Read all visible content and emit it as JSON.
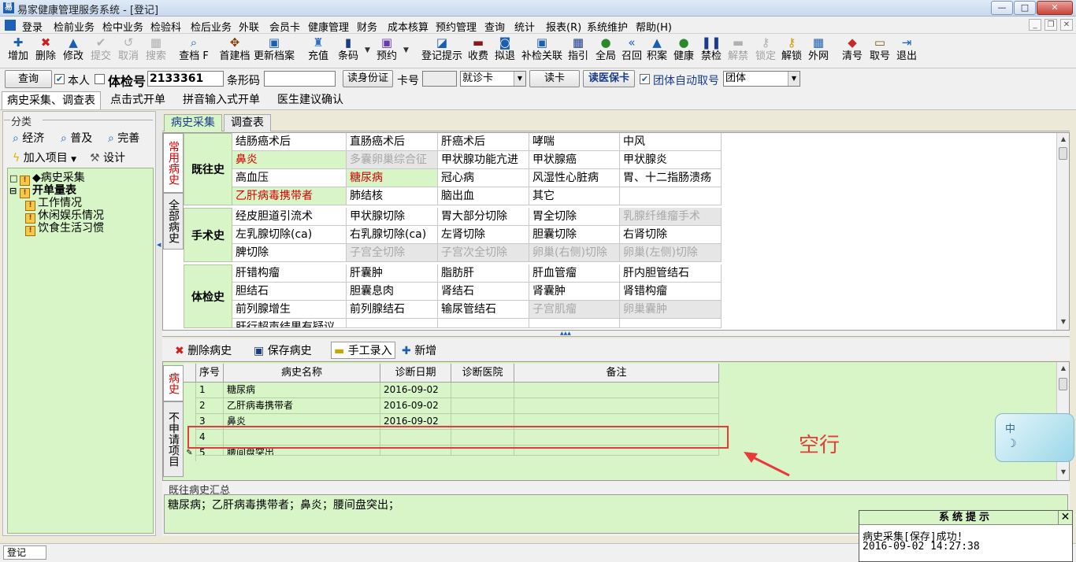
{
  "window": {
    "title": "易家健康管理服务系统 - [登记]",
    "app_icon": "app-logo-icon",
    "btn_min": "—",
    "btn_max": "□",
    "btn_close": "✕"
  },
  "menubar": [
    "登录",
    "检前业务",
    "检中业务",
    "检验科",
    "检后业务",
    "外联",
    "会员卡",
    "健康管理",
    "财务",
    "成本核算",
    "预约管理",
    "查询",
    "统计",
    "报表(R)",
    "系统维护",
    "帮助(H)"
  ],
  "mdi": [
    "_",
    "❐",
    "✕"
  ],
  "toolbar": [
    {
      "label": "增加",
      "icon": "✚",
      "color": "#1a5fb4"
    },
    {
      "label": "删除",
      "icon": "✖",
      "color": "#d21c1c"
    },
    {
      "label": "修改",
      "icon": "▲",
      "color": "#1a5fb4"
    },
    {
      "label": "提交",
      "icon": "✔",
      "color": "#b0b0b0",
      "disabled": true
    },
    {
      "label": "取消",
      "icon": "↺",
      "color": "#b0b0b0",
      "disabled": true
    },
    {
      "label": "搜索",
      "icon": "▦",
      "color": "#b0b0b0",
      "disabled": true
    },
    {
      "label": "查档 F",
      "icon": "⌕",
      "color": "#1a5fb4"
    },
    {
      "label": "首建档",
      "icon": "✥",
      "color": "#8a3a00"
    },
    {
      "label": "更新档案",
      "icon": "▣",
      "color": "#1a5fb4"
    },
    {
      "label": "充值",
      "icon": "♜",
      "color": "#2a6cc8"
    },
    {
      "label": "条码",
      "icon": "▮",
      "color": "#1a3c8a"
    },
    {
      "label": "预约",
      "icon": "▣",
      "color": "#6a3ab4"
    },
    {
      "label": "登记提示",
      "icon": "◪",
      "color": "#1a5fb4"
    },
    {
      "label": "收费",
      "icon": "▬",
      "color": "#8a1a1a"
    },
    {
      "label": "拟退",
      "icon": "◙",
      "color": "#1a5fb4"
    },
    {
      "label": "补检关联",
      "icon": "▣",
      "color": "#1a5fb4"
    },
    {
      "label": "指引",
      "icon": "▦",
      "color": "#1a3c8a"
    },
    {
      "label": "全局",
      "icon": "●",
      "color": "#2a8a2a"
    },
    {
      "label": "召回",
      "icon": "«",
      "color": "#1a5fb4"
    },
    {
      "label": "积案",
      "icon": "▲",
      "color": "#1a5fb4"
    },
    {
      "label": "健康",
      "icon": "●",
      "color": "#2a8a2a"
    },
    {
      "label": "禁检",
      "icon": "❚❚",
      "color": "#1a3c8a"
    },
    {
      "label": "解禁",
      "icon": "▬",
      "color": "#b0b0b0",
      "disabled": true
    },
    {
      "label": "锁定",
      "icon": "⚷",
      "color": "#b0b0b0",
      "disabled": true
    },
    {
      "label": "解锁",
      "icon": "⚷",
      "color": "#c89a00"
    },
    {
      "label": "外网",
      "icon": "▦",
      "color": "#1a5fb4"
    },
    {
      "label": "清号",
      "icon": "◆",
      "color": "#c82a2a"
    },
    {
      "label": "取号",
      "icon": "▭",
      "color": "#7a5a1a"
    },
    {
      "label": "退出",
      "icon": "⇥",
      "color": "#1a5fb4"
    }
  ],
  "search": {
    "query_btn": "查询",
    "self_label": "本人",
    "exam_no_label": "体检号",
    "exam_no_value": "2133361",
    "barcode_label": "条形码",
    "barcode_value": "",
    "read_id_btn": "读身份证",
    "card_label": "卡号",
    "card_value": "",
    "card_type": "就诊卡",
    "read_card_btn": "读卡",
    "read_insurance_btn": "读医保卡",
    "group_auto_label": "团体自动取号",
    "group_select": "团体"
  },
  "main_tabs": [
    "病史采集、调查表",
    "点击式开单",
    "拼音输入式开单",
    "医生建议确认"
  ],
  "left": {
    "header": "分类",
    "btns": [
      "经济",
      "普及",
      "完善"
    ],
    "add_item": "加入项目",
    "design": "设计",
    "tree": [
      {
        "label": "◆病史采集",
        "level": 0,
        "expander": "□"
      },
      {
        "label": "开单量表",
        "level": 0,
        "expander": "⊟",
        "bold": true
      },
      {
        "label": "工作情况",
        "level": 1
      },
      {
        "label": "休闲娱乐情况",
        "level": 1
      },
      {
        "label": "饮食生活习惯",
        "level": 1
      }
    ]
  },
  "history_tabs": [
    "病史采集",
    "调查表"
  ],
  "side_tabs": [
    "常用病史",
    "全部病史"
  ],
  "categories": [
    {
      "name": "既往史",
      "rows": [
        [
          {
            "t": "结肠癌术后"
          },
          {
            "t": "直肠癌术后"
          },
          {
            "t": "肝癌术后"
          },
          {
            "t": "哮喘"
          },
          {
            "t": "中风"
          }
        ],
        [
          {
            "t": "鼻炎",
            "s": "gr"
          },
          {
            "t": "多囊卵巢综合征",
            "s": "gray"
          },
          {
            "t": "甲状腺功能亢进"
          },
          {
            "t": "甲状腺癌"
          },
          {
            "t": "甲状腺炎"
          }
        ],
        [
          {
            "t": "高血压"
          },
          {
            "t": "糖尿病",
            "s": "gr"
          },
          {
            "t": "冠心病"
          },
          {
            "t": "风湿性心脏病"
          },
          {
            "t": "胃、十二指肠溃疡"
          }
        ],
        [
          {
            "t": "乙肝病毒携带者",
            "s": "gr"
          },
          {
            "t": "肺结核"
          },
          {
            "t": "脑出血"
          },
          {
            "t": "其它"
          },
          {
            "t": ""
          }
        ]
      ]
    },
    {
      "name": "手术史",
      "rows": [
        [
          {
            "t": "经皮胆道引流术"
          },
          {
            "t": "甲状腺切除"
          },
          {
            "t": "胃大部分切除"
          },
          {
            "t": "胃全切除"
          },
          {
            "t": "乳腺纤维瘤手术",
            "s": "gray"
          }
        ],
        [
          {
            "t": "左乳腺切除(ca)"
          },
          {
            "t": "右乳腺切除(ca)"
          },
          {
            "t": "左肾切除"
          },
          {
            "t": "胆囊切除"
          },
          {
            "t": "右肾切除"
          }
        ],
        [
          {
            "t": "脾切除"
          },
          {
            "t": "子宫全切除",
            "s": "gray"
          },
          {
            "t": "子宫次全切除",
            "s": "gray"
          },
          {
            "t": "卵巢(右侧)切除",
            "s": "gray"
          },
          {
            "t": "卵巢(左侧)切除",
            "s": "gray"
          }
        ]
      ]
    },
    {
      "name": "体检史",
      "rows": [
        [
          {
            "t": "肝错构瘤"
          },
          {
            "t": "肝囊肿"
          },
          {
            "t": "脂肪肝"
          },
          {
            "t": "肝血管瘤"
          },
          {
            "t": "肝内胆管结石"
          }
        ],
        [
          {
            "t": "胆结石"
          },
          {
            "t": "胆囊息肉"
          },
          {
            "t": "肾结石"
          },
          {
            "t": "肾囊肿"
          },
          {
            "t": "肾错构瘤"
          }
        ],
        [
          {
            "t": "前列腺增生"
          },
          {
            "t": "前列腺结石"
          },
          {
            "t": "输尿管结石"
          },
          {
            "t": "子宫肌瘤",
            "s": "gray"
          },
          {
            "t": "卵巢囊肿",
            "s": "gray"
          }
        ],
        [
          {
            "t": "肝行超声结果有疑议"
          },
          {
            "t": ""
          },
          {
            "t": ""
          },
          {
            "t": ""
          },
          {
            "t": ""
          }
        ]
      ]
    }
  ],
  "hist_toolbar": {
    "delete": "删除病史",
    "save": "保存病史",
    "manual": "手工录入",
    "add": "新增"
  },
  "lower_side_tabs": [
    "病史",
    "不申请项目"
  ],
  "lower_grid": {
    "headers": [
      "序号",
      "病史名称",
      "诊断日期",
      "诊断医院",
      "备注"
    ],
    "rows": [
      [
        "1",
        "糖尿病",
        "2016-09-02",
        "",
        ""
      ],
      [
        "2",
        "乙肝病毒携带者",
        "2016-09-02",
        "",
        ""
      ],
      [
        "3",
        "鼻炎",
        "2016-09-02",
        "",
        ""
      ],
      [
        "4",
        "",
        "",
        "",
        ""
      ],
      [
        "5",
        "腰间盘突出",
        "",
        "",
        ""
      ]
    ]
  },
  "annotation": "空行",
  "summary": {
    "label": "既往病史汇总",
    "text": "糖尿病；乙肝病毒携带者；鼻炎；腰间盘突出；"
  },
  "status": {
    "left": "登记"
  },
  "ime": {
    "text": "中"
  },
  "popup": {
    "title": "系统提示",
    "line1": "病史采集[保存]成功!",
    "line2": "2016-09-02 14:27:38"
  },
  "colors": {
    "accent_green": "#d7f5c7",
    "alert_red": "#d40000",
    "annotation_red": "#e83a3a"
  }
}
